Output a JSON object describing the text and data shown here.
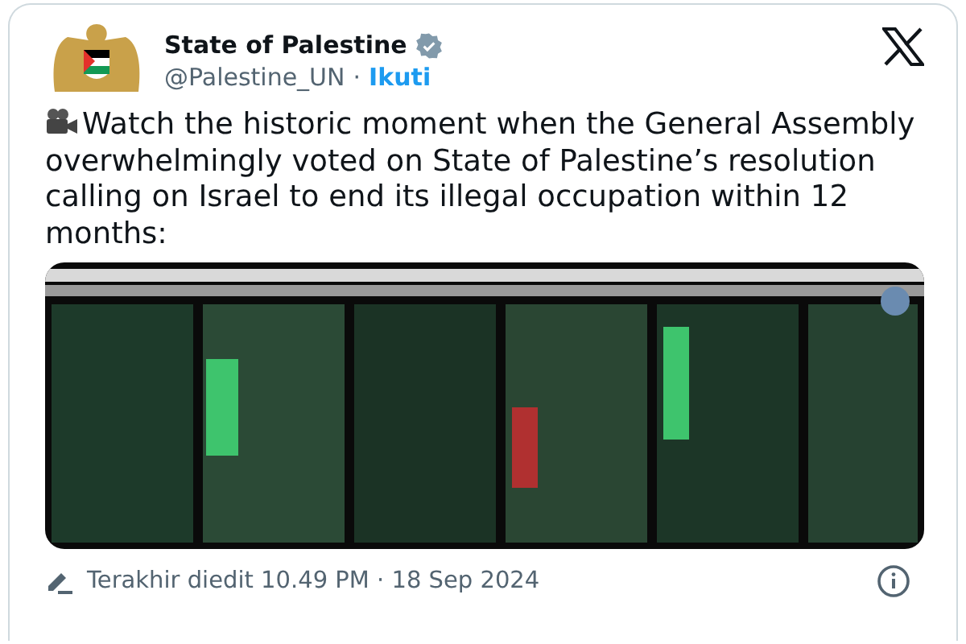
{
  "author": {
    "name": "State of Palestine",
    "verified": true,
    "handle": "@Palestine_UN",
    "separator": "·",
    "follow": "Ikuti"
  },
  "tweet": {
    "text": "Watch the historic moment when the General Assembly overwhelmingly voted on State of Palestine’s resolution calling on Israel to end its illegal occupation within 12 months:"
  },
  "footer": {
    "edited": "Terakhir diedit 10.49 PM · 18 Sep 2024"
  }
}
